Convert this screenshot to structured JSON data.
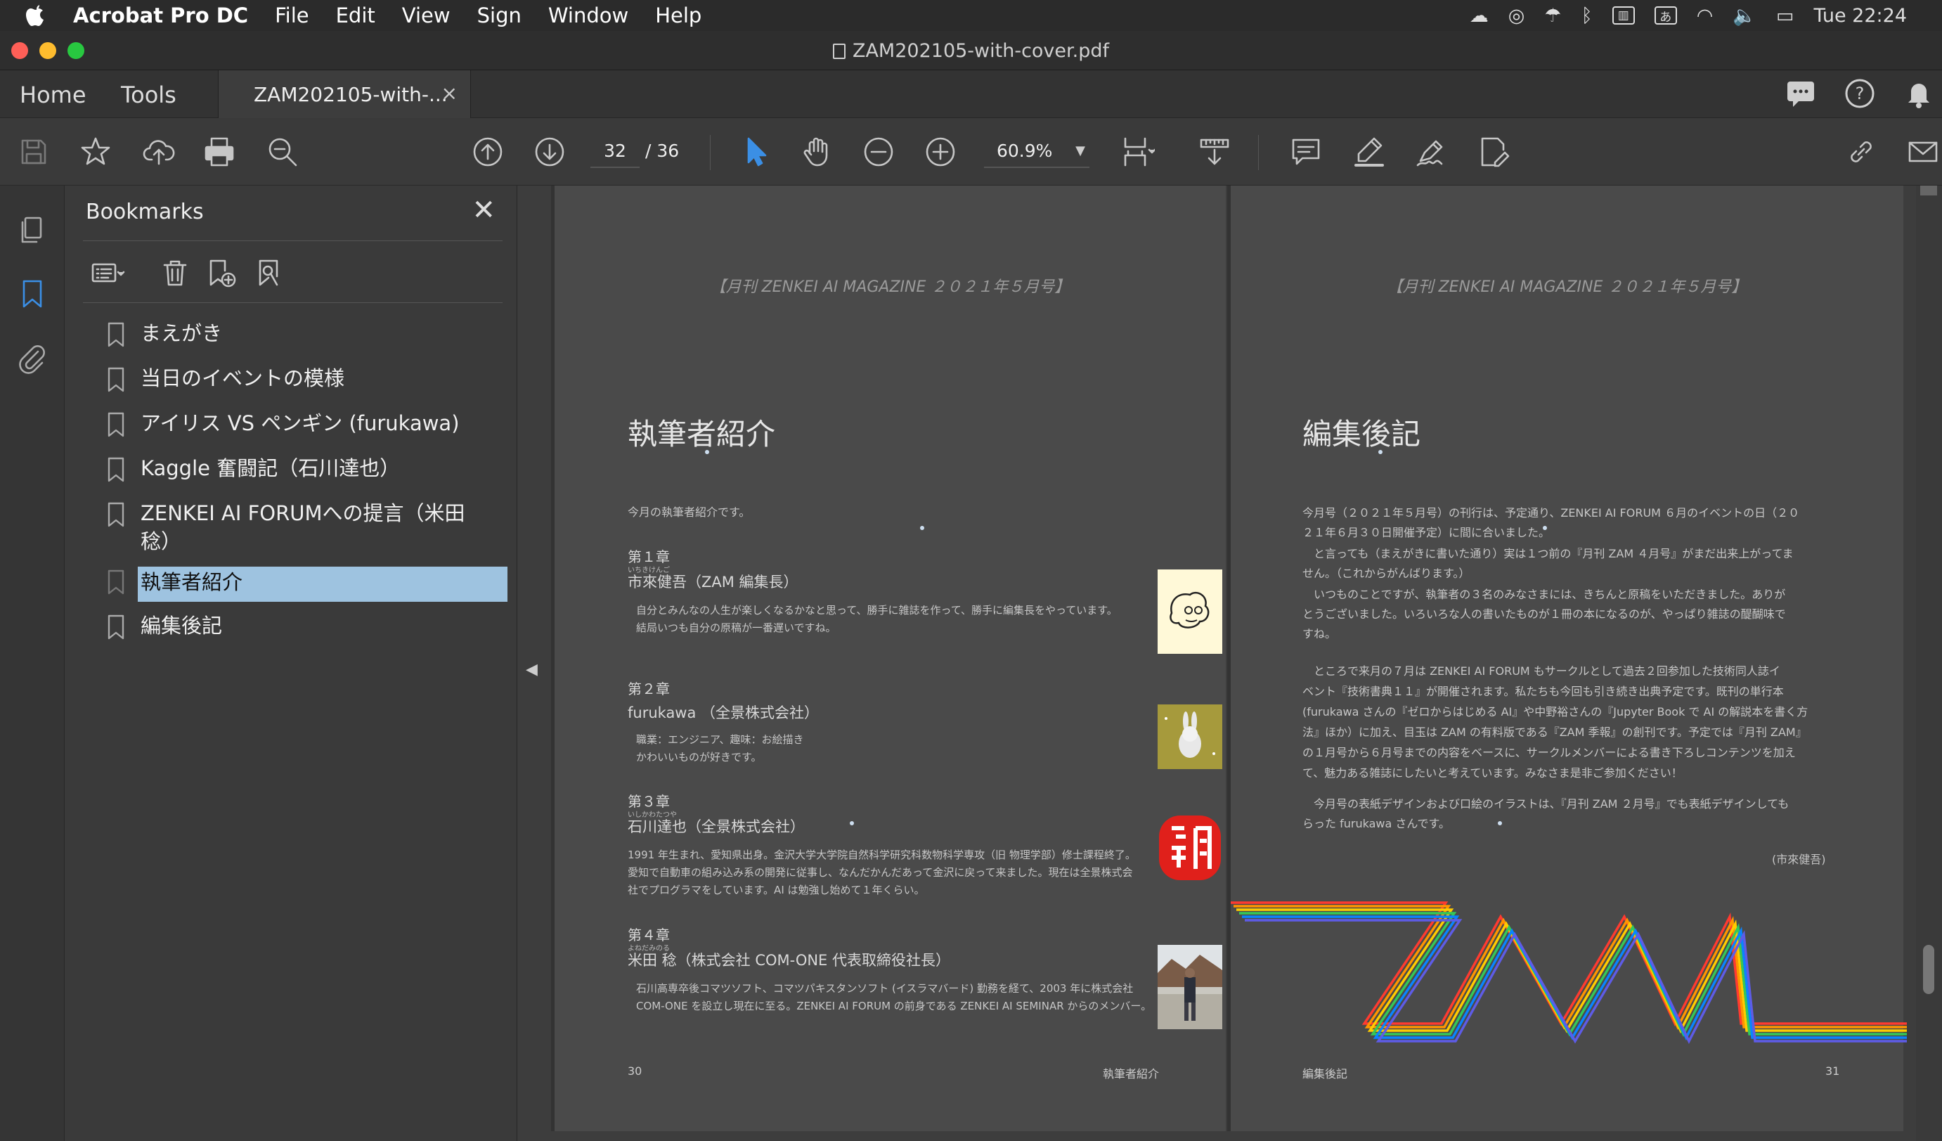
{
  "menubar": {
    "app": "Acrobat Pro DC",
    "items": [
      "File",
      "Edit",
      "View",
      "Sign",
      "Window",
      "Help"
    ],
    "clock": "Tue 22:24",
    "input_method": "あ"
  },
  "window": {
    "title": "ZAM202105-with-cover.pdf"
  },
  "tabs": {
    "home": "Home",
    "tools": "Tools",
    "document": "ZAM202105-with-...",
    "close": "×"
  },
  "toolbar": {
    "page_current": "32",
    "page_total": "/ 36",
    "zoom": "60.9%"
  },
  "bookmarks": {
    "title": "Bookmarks",
    "close": "✕",
    "items": [
      "まえがき",
      "当日のイベントの模様",
      "アイリス VS ペンギン (furukawa)",
      "Kaggle 奮闘記（石川達也）",
      "ZENKEI AI FORUMへの提言（米田稔）",
      "執筆者紹介",
      "編集後記"
    ],
    "selected_index": 5
  },
  "page_left": {
    "header": "【月刊 ZENKEI AI MAGAZINE ２０２１年５月号】",
    "title": "執筆者紹介",
    "intro": "今月の執筆者紹介です。",
    "chapters": [
      {
        "label": "第１章",
        "furigana": "いちきけんご",
        "author": "市來健吾（ZAM 編集長）",
        "body": "自分とみんなの人生が楽しくなるかなと思って、勝手に雑誌を作って、勝手に編集長をやっています。\n結局いつも自分の原稿が一番遅いですね。"
      },
      {
        "label": "第２章",
        "furigana": "",
        "author": "furukawa （全景株式会社）",
        "body": "職業：エンジニア、趣味：お絵描き\nかわいいものが好きです。"
      },
      {
        "label": "第３章",
        "furigana": "いしかわたつや",
        "author": "石川達也（全景株式会社）",
        "body": "1991 年生まれ、愛知県出身。金沢大学大学院自然科学研究科数物科学専攻（旧 物理学部）修士課程終了。\n愛知で自動車の組み込み系の開発に従事し、なんだかんだあって金沢に戻って来ました。現在は全景株式会\n社でプログラマをしています。AI は勉強し始めて１年くらい。"
      },
      {
        "label": "第４章",
        "furigana": "よねだみのる",
        "author": "米田 稔（株式会社 COM-ONE 代表取締役社長）",
        "body": "石川高専卒後コマツソフト、コマツパキスタンソフト (イスラマバード) 勤務を経て、2003 年に株式会社\nCOM-ONE を設立し現在に至る。ZENKEI AI FORUM の前身である ZENKEI AI SEMINAR からのメンバー。"
      }
    ],
    "footer_num": "30",
    "footer_section": "執筆者紹介"
  },
  "page_right": {
    "header": "【月刊 ZENKEI AI MAGAZINE ２０２１年５月号】",
    "title": "編集後記",
    "paragraphs": [
      "今月号（２０２１年５月号）の刊行は、予定通り、ZENKEI AI FORUM ６月のイベントの日（２０\n２１年６月３０日開催予定）に間に合いました。",
      "　と言っても（まえがきに書いた通り）実は１つ前の『月刊 ZAM ４月号』がまだ出来上がってま\nせん。（これからがんばります。）",
      "　いつものことですが、執筆者の３名のみなさまには、きちんと原稿をいただきました。ありが\nとうございました。いろいろな人の書いたものが１冊の本になるのが、やっぱり雑誌の醍醐味で\nすね。",
      "　ところで来月の７月は ZENKEI AI FORUM もサークルとして過去２回参加した技術同人誌イ\nベント『技術書典１１』が開催されます。私たちも今回も引き続き出典予定です。既刊の単行本\n(furukawa さんの『ゼロからはじめる AI』や中野裕さんの『Jupyter Book で AI の解説本を書く方\n法』ほか）に加え、目玉は ZAM の有料版である『ZAM 季報』の創刊です。予定では『月刊 ZAM』\nの１月号から６月号までの内容をベースに、サークルメンバーによる書き下ろしコンテンツを加え\nて、魅力ある雑誌にしたいと考えています。みなさま是非ご参加ください！",
      "　今月号の表紙デザインおよび口絵のイラストは、『月刊 ZAM ２月号』でも表紙デザインしても\nらった furukawa さんです。"
    ],
    "signature": "(市來健吾)",
    "footer_section": "編集後記",
    "footer_num": "31"
  },
  "colors": {
    "selection": "#9ec3e0",
    "accent_blue": "#3b8fe5",
    "stamp_red": "#e0201b"
  }
}
